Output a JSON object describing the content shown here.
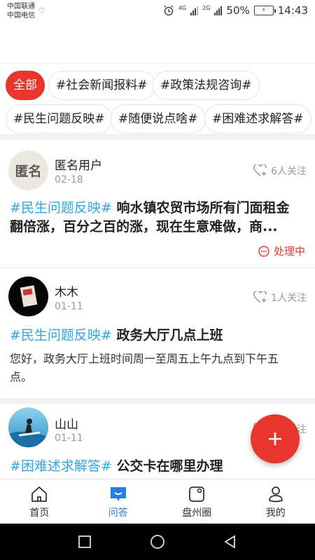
{
  "status_bar": {
    "carrier1": "中国联通",
    "carrier2": "中国电信",
    "network1": "4G",
    "network2": "2G",
    "battery": "50%",
    "time": "14:43"
  },
  "tags": {
    "all": "全部",
    "t1": "#社会新闻报料#",
    "t2": "#政策法规咨询#",
    "t3": "#民生问题反映#",
    "t4": "#随便说点啥#",
    "t5": "#困难述求解答#"
  },
  "posts": [
    {
      "avatar_text": "匿名",
      "user": "匿名用户",
      "date": "02-18",
      "follow": "6人关注",
      "hashtag": "#民生问题反映#",
      "title_line1": " 响水镇农贸市场所有门面租金",
      "title_line2": "翻倍涨，百分之百的涨，现在生意难做，商...",
      "status": "处理中"
    },
    {
      "user": "木木",
      "date": "01-11",
      "follow": "1人关注",
      "hashtag": "#民生问题反映#",
      "title": " 政务大厅几点上班",
      "body_line1": "您好，政务大厅上班时间周一至周五上午九点到下午五",
      "body_line2": "点。"
    },
    {
      "user": "山山",
      "date": "01-11",
      "follow": "1人关注",
      "hashtag": "#困难述求解答#",
      "title": " 公交卡在哪里办理"
    }
  ],
  "tabbar": {
    "home": "首页",
    "qa": "问答",
    "circle": "盘州圈",
    "mine": "我的"
  },
  "colors": {
    "accent": "#e8362f",
    "hashtag": "#2ea7e0",
    "tab_active": "#2a7de1"
  }
}
